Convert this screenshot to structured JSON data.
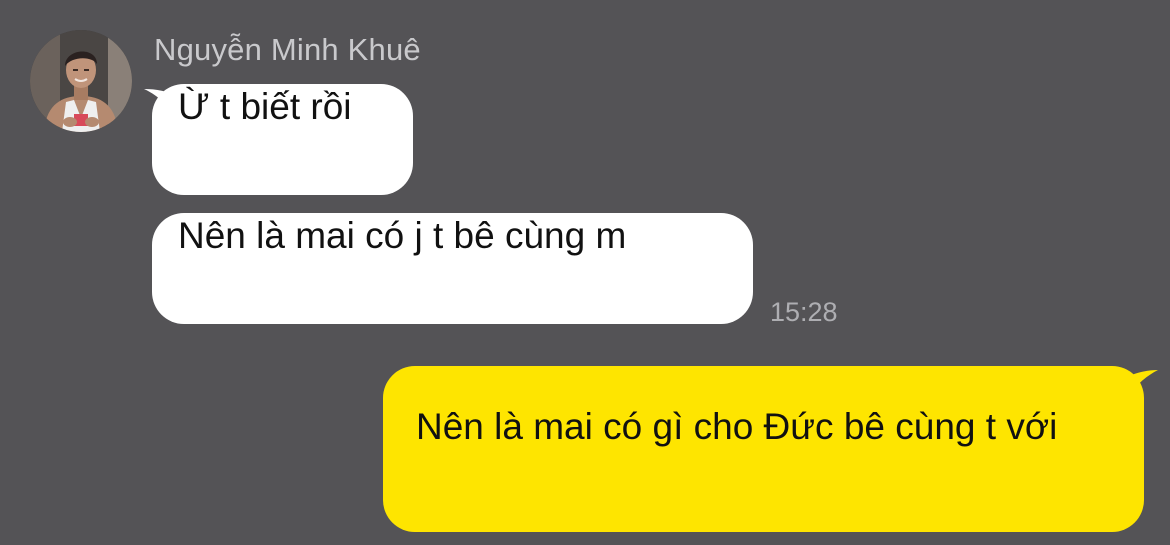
{
  "chat": {
    "sender_name": "Nguyễn Minh Khuê",
    "incoming": [
      {
        "text": "Ừ t biết rồi"
      },
      {
        "text": "Nên là mai có j t bê cùng m"
      }
    ],
    "incoming_time": "15:28",
    "outgoing": [
      {
        "text": "Nên là mai có gì cho Đức bê cùng t với"
      }
    ]
  },
  "colors": {
    "background": "#545356",
    "incoming_bubble": "#ffffff",
    "outgoing_bubble": "#fee500",
    "name_text": "#c9c9cc",
    "time_text": "#aeaeb2"
  }
}
